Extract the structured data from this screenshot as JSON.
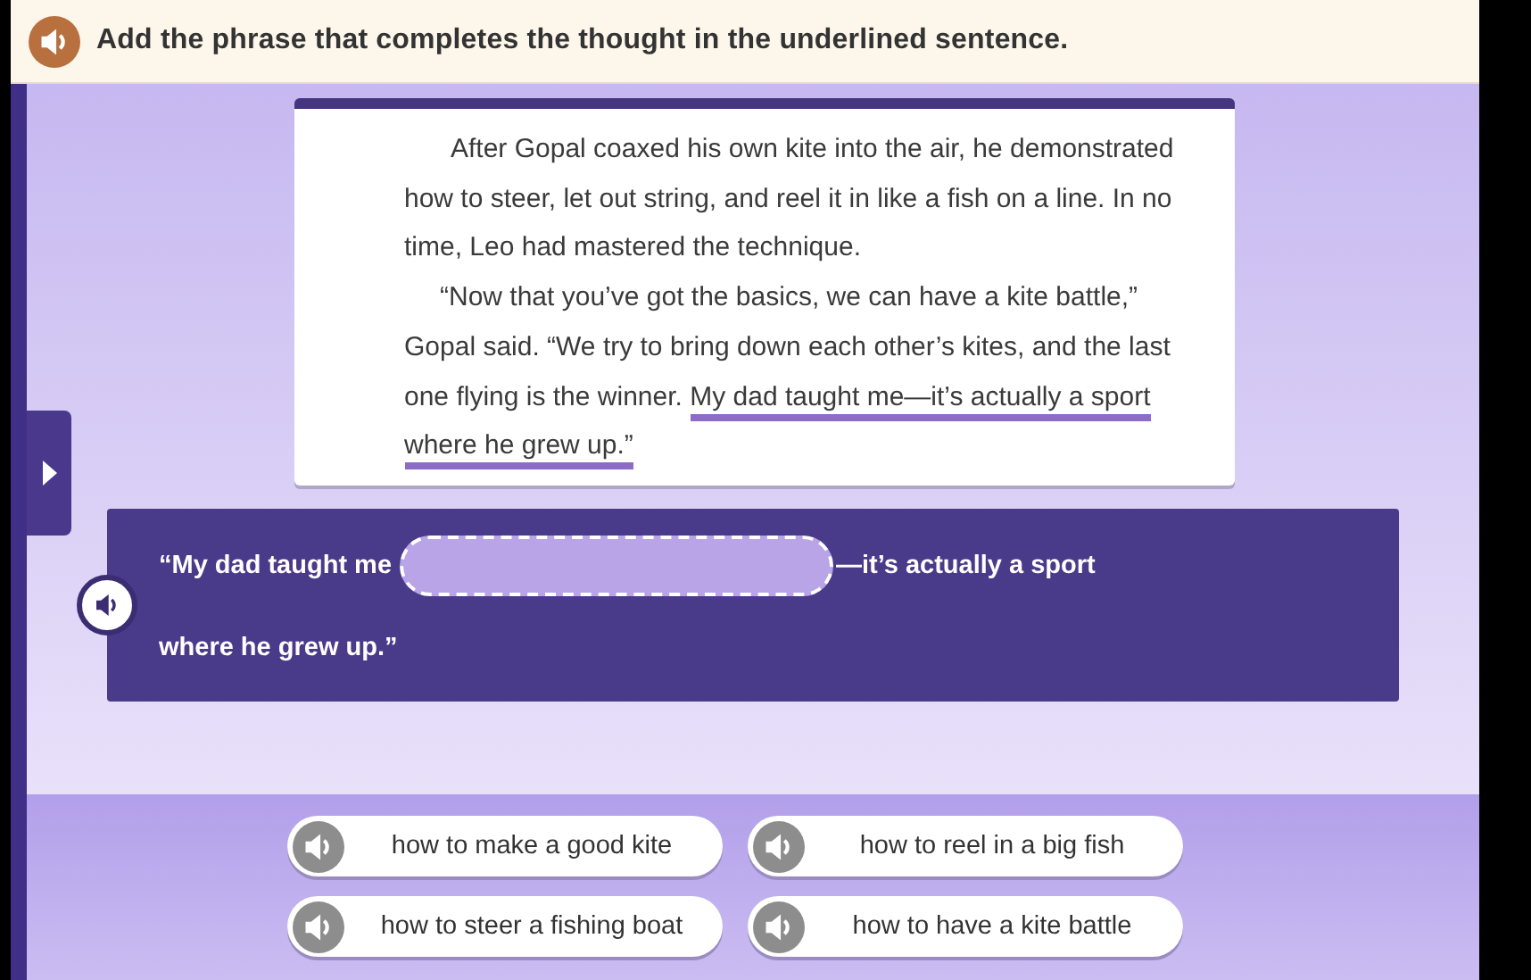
{
  "instruction": {
    "text": "Add the phrase that completes the thought in the underlined sentence."
  },
  "passage": [
    {
      "segments": [
        {
          "text": "After Gopal coaxed his own kite into the air, he demonstrated how to steer, let out string, and reel it in like a fish on a line. In no time, Leo had mastered the technique.",
          "underlined": false
        }
      ]
    },
    {
      "segments": [
        {
          "text": "“Now that you’ve got the basics, we can have a kite battle,” Gopal said. “We try to bring down each other’s kites, and the last one flying is the winner. ",
          "underlined": false
        },
        {
          "text": "My dad taught me—it’s actually a sport where he grew up.”",
          "underlined": true
        }
      ]
    }
  ],
  "sentence": {
    "before": "“My dad taught me",
    "after": "—it’s actually a sport where he grew up.”",
    "blank_filled": false
  },
  "choices": [
    {
      "text": "how to make a good kite"
    },
    {
      "text": "how to reel in a big fish"
    },
    {
      "text": "how to steer a fishing boat"
    },
    {
      "text": "how to have a kite battle"
    }
  ]
}
